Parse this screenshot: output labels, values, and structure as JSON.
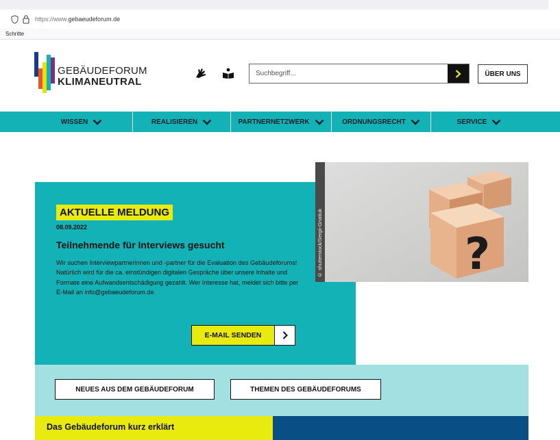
{
  "browser": {
    "url_prefix": "https://www.",
    "url_domain": "gebaeudeforum.de",
    "bookmark_label": "Schritte"
  },
  "header": {
    "logo_line1": "GEBÄUDEFORUM",
    "logo_line2": "KLIMANEUTRAL",
    "logo_colors": [
      "#1a3a8f",
      "#e6e20f",
      "#e8572a",
      "#17b3b4",
      "#7b2d8b"
    ],
    "search_placeholder": "Suchbegriff...",
    "about_label": "ÜBER UNS",
    "icons": [
      "sign-language-icon",
      "easy-read-icon",
      "search-submit-icon"
    ]
  },
  "nav": {
    "items": [
      {
        "label": "WISSEN"
      },
      {
        "label": "REALISIEREN"
      },
      {
        "label": "PARTNERNETZWERK"
      },
      {
        "label": "ORDNUNGSRECHT"
      },
      {
        "label": "SERVICE"
      }
    ]
  },
  "hero": {
    "badge": "AKTUELLE MELDUNG",
    "date": "08.09.2022",
    "title": "Teilnehmende für Interviews gesucht",
    "text": "Wir suchen Interviewpartnerinnen und -partner für die Evaluation des Gebäudeforums! Natürlich wird für die ca. einstündigen digitalen Gespräche über unsere Inhalte und Formate eine Aufwandsentschädigung gezahlt. Wer Interesse hat, meldet sich bitte per E-Mail an info@gebaeudeforum.de.",
    "button_label": "E-MAIL SENDEN",
    "photo_credit": "© shutterstock/Sergii-Gnatiuk"
  },
  "band": {
    "btn_news": "NEUES AUS DEM GEBÄUDEFORUM",
    "btn_topics": "THEMEN DES GEBÄUDEFORUMS",
    "explained_title": "Das Gebäudeforum kurz erklärt"
  },
  "colors": {
    "teal": "#12b2b6",
    "light_teal": "#a3e0e2",
    "yellow": "#e9ea0d",
    "dark_blue": "#0a4e86"
  }
}
